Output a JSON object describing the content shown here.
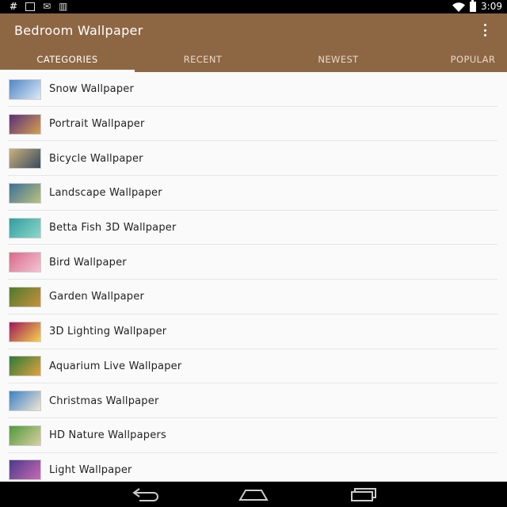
{
  "status_bar": {
    "time": "3:09",
    "icons": [
      "hash-icon",
      "download-icon",
      "email-icon",
      "barcode-icon",
      "wifi-icon",
      "battery-icon"
    ]
  },
  "app_bar": {
    "title": "Bedroom Wallpaper",
    "background_color": "#8d6744",
    "overflow_icon": "more-vert-icon"
  },
  "tabs": [
    {
      "label": "CATEGORIES",
      "selected": true
    },
    {
      "label": "RECENT",
      "selected": false
    },
    {
      "label": "NEWEST",
      "selected": false
    },
    {
      "label": "POPULAR",
      "selected": false
    }
  ],
  "categories": [
    {
      "label": "Snow Wallpaper",
      "thumb": [
        "#4f86c6",
        "#dce9f5"
      ]
    },
    {
      "label": "Portrait Wallpaper",
      "thumb": [
        "#5a2e7a",
        "#d6a04f"
      ]
    },
    {
      "label": "Bicycle Wallpaper",
      "thumb": [
        "#c9b27a",
        "#3b4a5e"
      ]
    },
    {
      "label": "Landscape Wallpaper",
      "thumb": [
        "#3c6f9a",
        "#b9c27a"
      ]
    },
    {
      "label": "Betta Fish 3D Wallpaper",
      "thumb": [
        "#2f9fa0",
        "#8fd6c9"
      ]
    },
    {
      "label": "Bird Wallpaper",
      "thumb": [
        "#d96a8a",
        "#f4c4d4"
      ]
    },
    {
      "label": "Garden Wallpaper",
      "thumb": [
        "#4e7a2e",
        "#c8913c"
      ]
    },
    {
      "label": "3D Lighting Wallpaper",
      "thumb": [
        "#a0185a",
        "#f5d24a"
      ]
    },
    {
      "label": "Aquarium Live Wallpaper",
      "thumb": [
        "#2c7a3a",
        "#e2a23c"
      ]
    },
    {
      "label": "Christmas Wallpaper",
      "thumb": [
        "#3a82c4",
        "#f0e6d2"
      ]
    },
    {
      "label": "HD Nature Wallpapers",
      "thumb": [
        "#4e9a3c",
        "#d8d0a0"
      ]
    },
    {
      "label": "Light Wallpaper",
      "thumb": [
        "#4a3a8a",
        "#c86ab4"
      ]
    }
  ],
  "nav_bar": {
    "buttons": [
      "back-icon",
      "home-icon",
      "recents-icon"
    ]
  }
}
